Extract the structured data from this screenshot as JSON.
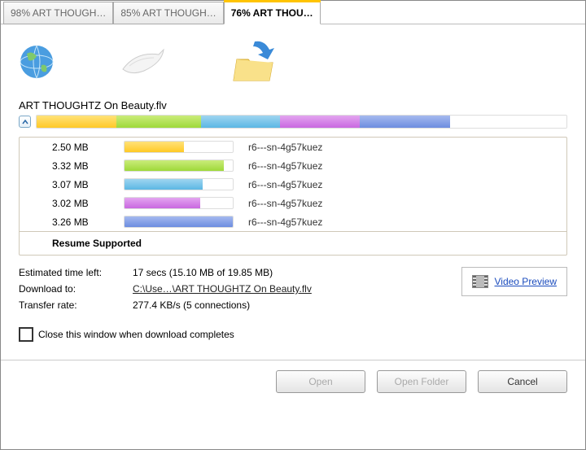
{
  "tabs": [
    {
      "label": "98% ART THOUGH…",
      "active": false
    },
    {
      "label": "85% ART THOUGH…",
      "active": false
    },
    {
      "label": "76% ART THOU…",
      "active": true
    }
  ],
  "filename": "ART THOUGHTZ On Beauty.flv",
  "main_progress": {
    "segments": [
      {
        "cls": "seg-yellow",
        "pct": 15
      },
      {
        "cls": "seg-green",
        "pct": 16
      },
      {
        "cls": "seg-blue",
        "pct": 15
      },
      {
        "cls": "seg-purple",
        "pct": 15
      },
      {
        "cls": "seg-blue2",
        "pct": 17
      },
      {
        "cls": "seg-empty",
        "pct": 22
      }
    ]
  },
  "threads": [
    {
      "size": "2.50 MB",
      "color": "seg-yellow",
      "pct": 55,
      "host": "r6---sn-4g57kuez"
    },
    {
      "size": "3.32 MB",
      "color": "seg-green",
      "pct": 92,
      "host": "r6---sn-4g57kuez"
    },
    {
      "size": "3.07 MB",
      "color": "seg-blue",
      "pct": 72,
      "host": "r6---sn-4g57kuez"
    },
    {
      "size": "3.02 MB",
      "color": "seg-purple",
      "pct": 70,
      "host": "r6---sn-4g57kuez"
    },
    {
      "size": "3.26 MB",
      "color": "seg-blue2",
      "pct": 100,
      "host": "r6---sn-4g57kuez"
    }
  ],
  "resume_label": "Resume Supported",
  "info": {
    "eta_label": "Estimated time left:",
    "eta_value": "17 secs (15.10 MB of 19.85 MB)",
    "dest_label": "Download to:",
    "dest_value": "C:\\Use…\\ART THOUGHTZ On Beauty.flv",
    "rate_label": "Transfer rate:",
    "rate_value": "277.4 KB/s (5 connections)"
  },
  "preview_label": "Video Preview",
  "close_checkbox_label": "Close this window when download completes",
  "buttons": {
    "open": "Open",
    "open_folder": "Open Folder",
    "cancel": "Cancel"
  }
}
